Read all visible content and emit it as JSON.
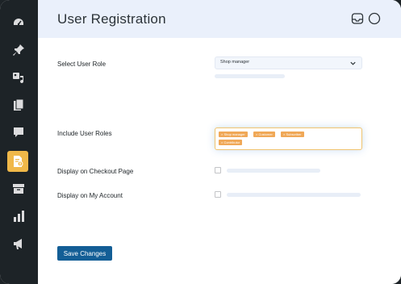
{
  "sidebar": {
    "items": [
      {
        "icon": "dashboard-icon"
      },
      {
        "icon": "pin-icon"
      },
      {
        "icon": "media-icon"
      },
      {
        "icon": "pages-icon"
      },
      {
        "icon": "comments-icon"
      },
      {
        "icon": "user-registration-icon",
        "active": true
      },
      {
        "icon": "archive-icon"
      },
      {
        "icon": "analytics-icon"
      },
      {
        "icon": "marketing-icon"
      }
    ]
  },
  "header": {
    "title": "User Registration",
    "icons": [
      "inbox-icon",
      "circle-icon"
    ]
  },
  "form": {
    "select_user_role": {
      "label": "Select User Role",
      "value": "Shop manager"
    },
    "include_user_roles": {
      "label": "Include User Roles",
      "tags": [
        "× Shop manager",
        "× Customer",
        "× Subscriber",
        "× Contributor"
      ]
    },
    "display_checkout": {
      "label": "Display on Checkout Page",
      "checked": false
    },
    "display_account": {
      "label": "Display on My Account",
      "checked": false
    },
    "save_label": "Save Changes"
  },
  "colors": {
    "sidebar": "#1d2327",
    "active": "#f0b849",
    "header": "#eaf0fb",
    "button": "#135e96",
    "tag": "#f0a857"
  }
}
